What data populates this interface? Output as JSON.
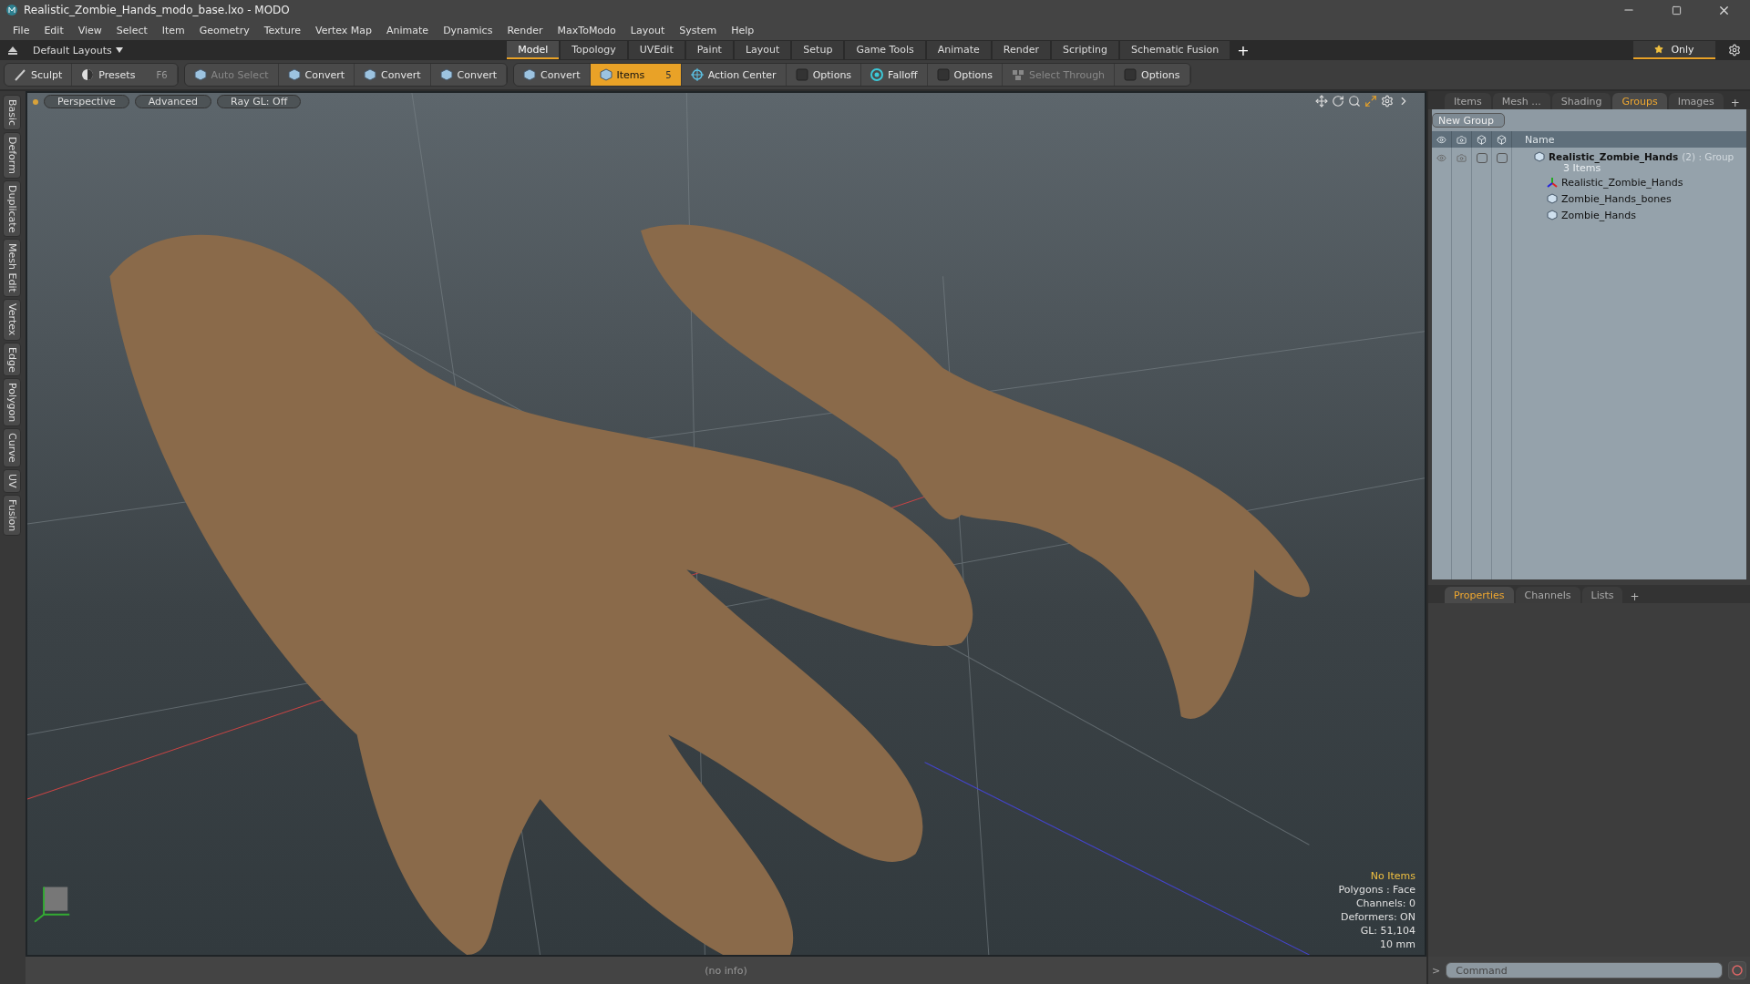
{
  "window": {
    "title": "Realistic_Zombie_Hands_modo_base.lxo - MODO"
  },
  "menu": [
    "File",
    "Edit",
    "View",
    "Select",
    "Item",
    "Geometry",
    "Texture",
    "Vertex Map",
    "Animate",
    "Dynamics",
    "Render",
    "MaxToModo",
    "Layout",
    "System",
    "Help"
  ],
  "layout_bar": {
    "preset": "Default Layouts",
    "tabs": [
      {
        "label": "Model",
        "selected": true
      },
      {
        "label": "Topology",
        "selected": false
      },
      {
        "label": "UVEdit",
        "selected": false
      },
      {
        "label": "Paint",
        "selected": false
      },
      {
        "label": "Layout",
        "selected": false
      },
      {
        "label": "Setup",
        "selected": false
      },
      {
        "label": "Game Tools",
        "selected": false
      },
      {
        "label": "Animate",
        "selected": false
      },
      {
        "label": "Render",
        "selected": false
      },
      {
        "label": "Scripting",
        "selected": false
      },
      {
        "label": "Schematic Fusion",
        "selected": false
      }
    ],
    "add": "+",
    "only": "Only"
  },
  "toolbar": [
    [
      {
        "label": "Sculpt",
        "kind": "brush",
        "selected": false,
        "disabled": false
      },
      {
        "label": "Presets",
        "kind": "presets",
        "selected": false,
        "disabled": false,
        "shortcut": "F6"
      }
    ],
    [
      {
        "label": "Auto Select",
        "kind": "cube",
        "selected": false,
        "disabled": true
      },
      {
        "label": "Convert",
        "kind": "cube",
        "selected": false,
        "disabled": false
      },
      {
        "label": "Convert",
        "kind": "cube",
        "selected": false,
        "disabled": false
      },
      {
        "label": "Convert",
        "kind": "cube",
        "selected": false,
        "disabled": false
      }
    ],
    [
      {
        "label": "Convert",
        "kind": "cube",
        "selected": false,
        "disabled": false
      },
      {
        "label": "Items",
        "kind": "cube",
        "selected": true,
        "disabled": false,
        "shortcut": "5"
      },
      {
        "label": "Action Center",
        "kind": "target",
        "selected": false,
        "disabled": false
      },
      {
        "label": "Options",
        "kind": "box",
        "selected": false,
        "disabled": false
      },
      {
        "label": "Falloff",
        "kind": "ring",
        "selected": false,
        "disabled": false
      },
      {
        "label": "Options",
        "kind": "box",
        "selected": false,
        "disabled": false
      },
      {
        "label": "Select Through",
        "kind": "cubes",
        "selected": false,
        "disabled": true
      },
      {
        "label": "Options",
        "kind": "box",
        "selected": false,
        "disabled": false
      }
    ]
  ],
  "left_tabs": [
    "Basic",
    "Deform",
    "Duplicate",
    "Mesh Edit",
    "Vertex",
    "Edge",
    "Polygon",
    "Curve",
    "UV",
    "Fusion"
  ],
  "viewport": {
    "buttons": [
      "Perspective",
      "Advanced",
      "Ray GL: Off"
    ],
    "info": [
      {
        "text": "No Items",
        "kind": "highlight"
      },
      {
        "text": "Polygons : Face",
        "kind": "normal"
      },
      {
        "text": "Channels: 0",
        "kind": "normal"
      },
      {
        "text": "Deformers: ON",
        "kind": "normal"
      },
      {
        "text": "GL: 51,104",
        "kind": "normal"
      },
      {
        "text": "10 mm",
        "kind": "normal"
      }
    ]
  },
  "right_panel": {
    "tabs": [
      {
        "label": "Items",
        "selected": false
      },
      {
        "label": "Mesh ...",
        "selected": false
      },
      {
        "label": "Shading",
        "selected": false
      },
      {
        "label": "Groups",
        "selected": true
      },
      {
        "label": "Images",
        "selected": false
      }
    ],
    "add": "+",
    "new_group": "New Group",
    "column": "Name",
    "group": {
      "name": "Realistic_Zombie_Hands",
      "count": "(2)",
      "type": ": Group",
      "subtitle": "3 Items",
      "render_checked": false,
      "lock_checked": false,
      "children": [
        {
          "name": "Realistic_Zombie_Hands",
          "kind": "locator"
        },
        {
          "name": "Zombie_Hands_bones",
          "kind": "mesh"
        },
        {
          "name": "Zombie_Hands",
          "kind": "mesh"
        }
      ]
    }
  },
  "properties_tabs": [
    {
      "label": "Properties",
      "selected": true
    },
    {
      "label": "Channels",
      "selected": false
    },
    {
      "label": "Lists",
      "selected": false
    }
  ],
  "properties_add": "+",
  "command": {
    "prompt": ">",
    "placeholder": "Command"
  },
  "status": "(no info)"
}
